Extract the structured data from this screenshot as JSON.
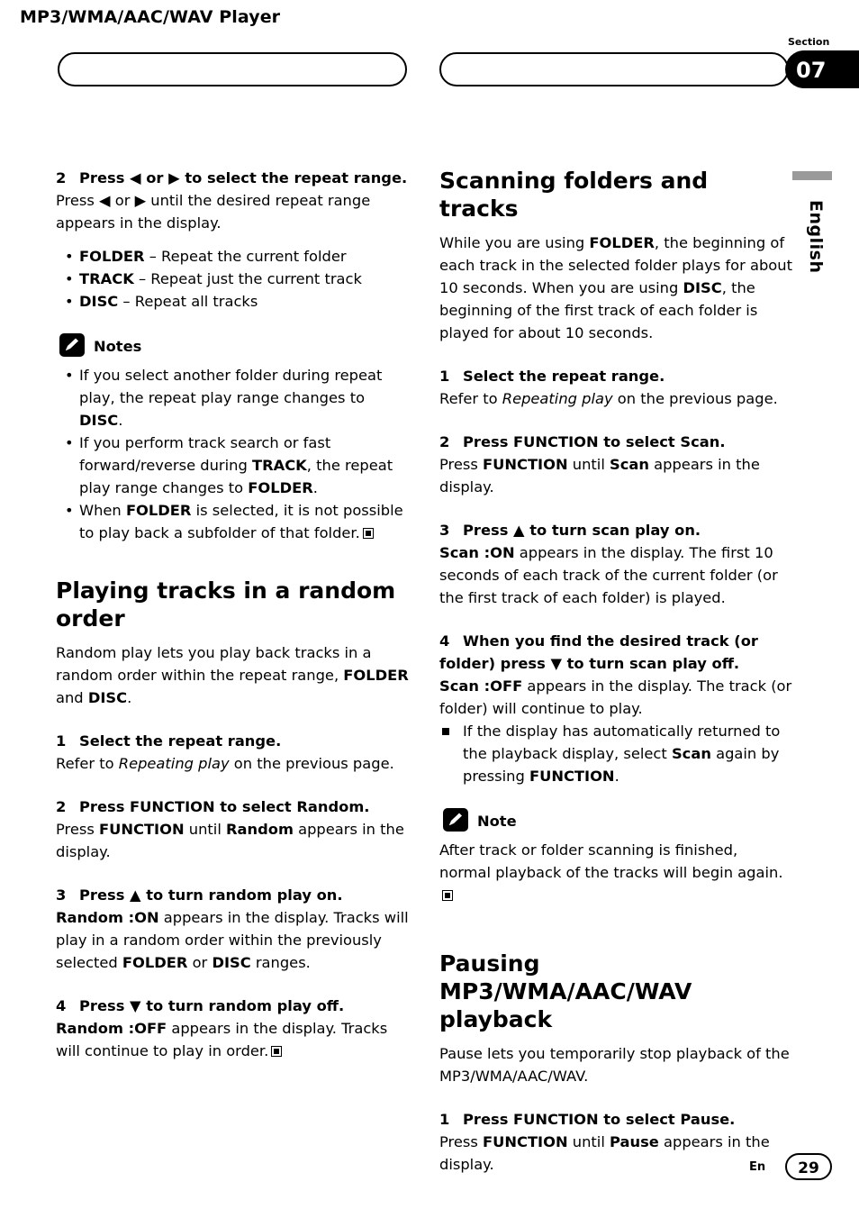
{
  "header": {
    "title": "MP3/WMA/AAC/WAV Player",
    "section_label": "Section",
    "section_number": "07",
    "language": "English"
  },
  "footer": {
    "lang_code": "En",
    "page_number": "29"
  },
  "left_column": {
    "step2": {
      "num": "2",
      "title": "Press ◀ or ▶ to select the repeat range.",
      "body_1": "Press ",
      "body_2": " or ",
      "body_3": " until the desired repeat range appears in the display.",
      "arrow_left": "◀",
      "arrow_right": "▶"
    },
    "range_list": [
      {
        "term": "FOLDER",
        "desc": " – Repeat the current folder"
      },
      {
        "term": "TRACK",
        "desc": " – Repeat just the current track"
      },
      {
        "term": "DISC",
        "desc": " – Repeat all tracks"
      }
    ],
    "notes_label": "Notes",
    "notes": [
      {
        "a": "If you select another folder during repeat play, the repeat play range changes to ",
        "b": "DISC",
        "c": "."
      },
      {
        "a": "If you perform track search or fast forward/reverse during ",
        "b": "TRACK",
        "c": ", the repeat play range changes to ",
        "d": "FOLDER",
        "e": "."
      },
      {
        "a": "When ",
        "b": "FOLDER",
        "c": " is selected, it is not possible to play back a subfolder of that folder."
      }
    ],
    "random_heading": "Playing tracks in a random order",
    "random_intro_1": "Random play lets you play back tracks in a random order within the repeat range, ",
    "random_intro_folder": "FOLDER",
    "random_intro_and": " and ",
    "random_intro_disc": "DISC",
    "random_intro_end": ".",
    "step1": {
      "num": "1",
      "title": "Select the repeat range.",
      "body_1": "Refer to ",
      "body_italic": "Repeating play",
      "body_2": " on the previous page."
    },
    "step2b": {
      "num": "2",
      "title": "Press FUNCTION to select Random.",
      "body_1": "Press ",
      "body_bold1": "FUNCTION",
      "body_2": " until ",
      "body_bold2": "Random",
      "body_3": " appears in the display."
    },
    "step3": {
      "num": "3",
      "title": "Press ▲ to turn random play on.",
      "body_bold1": "Random :ON",
      "body_1": " appears in the display. Tracks will play in a random order within the previously selected ",
      "body_bold2": "FOLDER",
      "body_2": " or ",
      "body_bold3": "DISC",
      "body_3": " ranges."
    },
    "step4": {
      "num": "4",
      "title": "Press ▼ to turn random play off.",
      "body_bold1": "Random :OFF",
      "body_1": " appears in the display. Tracks will continue to play in order."
    }
  },
  "right_column": {
    "scan_heading": "Scanning folders and tracks",
    "scan_intro_1": "While you are using ",
    "scan_intro_folder": "FOLDER",
    "scan_intro_2": ", the beginning of each track in the selected folder plays for about 10 seconds. When you are using ",
    "scan_intro_disc": "DISC",
    "scan_intro_3": ", the beginning of the first track of each folder is played for about 10 seconds.",
    "step1": {
      "num": "1",
      "title": "Select the repeat range.",
      "body_1": "Refer to ",
      "body_italic": "Repeating play",
      "body_2": " on the previous page."
    },
    "step2": {
      "num": "2",
      "title": "Press FUNCTION to select Scan.",
      "body_1": "Press ",
      "body_bold1": "FUNCTION",
      "body_2": " until ",
      "body_bold2": "Scan",
      "body_3": " appears in the display."
    },
    "step3": {
      "num": "3",
      "title": "Press ▲ to turn scan play on.",
      "body_bold1": "Scan :ON",
      "body_1": " appears in the display. The first 10 seconds of each track of the current folder (or the first track of each folder) is played."
    },
    "step4": {
      "num": "4",
      "title": "When you find the desired track (or folder) press ▼ to turn scan play off.",
      "body_bold1": "Scan :OFF",
      "body_1": " appears in the display. The track (or folder) will continue to play."
    },
    "scan_square_note": {
      "a": "If the display has automatically returned to the playback display, select ",
      "b": "Scan",
      "c": " again by pressing ",
      "d": "FUNCTION",
      "e": "."
    },
    "note_label": "Note",
    "note_text": "After track or folder scanning is finished, normal playback of the tracks will begin again.",
    "pause_heading": "Pausing MP3/WMA/AAC/WAV playback",
    "pause_intro": "Pause lets you temporarily stop playback of the MP3/WMA/AAC/WAV.",
    "pause_step1": {
      "num": "1",
      "title": "Press FUNCTION to select Pause.",
      "body_1": "Press ",
      "body_bold1": "FUNCTION",
      "body_2": " until ",
      "body_bold2": "Pause",
      "body_3": " appears in the display."
    }
  }
}
